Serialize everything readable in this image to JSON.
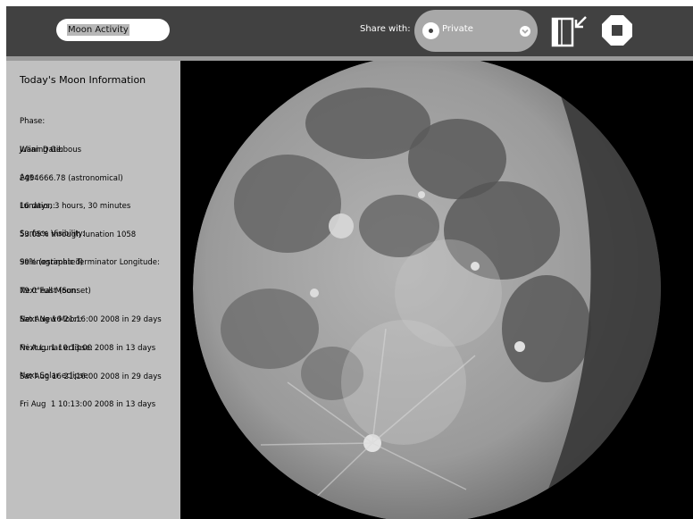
{
  "toolbar": {
    "activity_title": "Moon Activity",
    "share_label": "Share with:",
    "share_value": "Private",
    "journal_icon": "journal-keep-icon",
    "stop_icon": "stop-icon"
  },
  "panel": {
    "title": "Today's Moon Information",
    "entries": [
      {
        "label": "Phase:",
        "value": "Waning Gibbous"
      },
      {
        "label": "Julian Date:",
        "value": "2454666.78 (astronomical)"
      },
      {
        "label": "Age:",
        "value": "16 days, 3 hours, 30 minutes"
      },
      {
        "label": "Lunation:",
        "value": "53.05% through lunation 1058"
      },
      {
        "label": "Surface Visibility:",
        "value": "99% (estimated)"
      },
      {
        "label": "Selenographic Terminator Longitude:",
        "value": "79.0°east (Sunset)"
      },
      {
        "label": "Next Full Moon:",
        "value": "Sat Aug 16 21:16:00 2008 in 29 days"
      },
      {
        "label": "Next New Moon:",
        "value": "Fri Aug  1 10:13:00 2008 in 13 days"
      },
      {
        "label": "Next Lunar eclipse:",
        "value": "Sat Aug 16 21:16:00 2008 in 29 days"
      },
      {
        "label": "Next Solar eclipse:",
        "value": "Fri Aug  1 10:13:00 2008 in 13 days"
      }
    ]
  },
  "moon_image": {
    "phase_shadow": "waning-gibbous",
    "colors": {
      "surface": "#9a9a9a",
      "maria": "#5a5a5a",
      "shadow": "#3a3a3a"
    }
  }
}
